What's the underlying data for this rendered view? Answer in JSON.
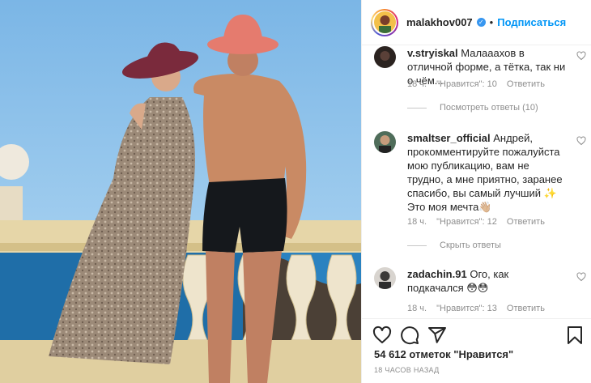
{
  "post": {
    "username": "malakhov007",
    "verified_icon": "verified-badge-icon",
    "separator": "•",
    "follow_label": "Подписаться"
  },
  "comments": [
    {
      "username": "v.stryiskal",
      "text": "Малааахов в отличной форме, а тётка, так ни о чём...",
      "time": "18 ч.",
      "likes": "\"Нравится\": 10",
      "reply": "Ответить",
      "replies_label": "Посмотреть ответы (10)"
    },
    {
      "username": "smaltser_official",
      "text": "Андрей, прокомментируйте пожалуйста мою публикацию, вам не трудно, а мне приятно, заранее спасибо, вы самый лучший ✨ Это моя мечта👋🏼",
      "time": "18 ч.",
      "likes": "\"Нравится\": 12",
      "reply": "Ответить",
      "replies_label": "Скрыть ответы"
    },
    {
      "username": "zadachin.91",
      "text": "Ого, как подкачался 😳😳",
      "time": "18 ч.",
      "likes": "\"Нравится\": 13",
      "reply": "Ответить"
    }
  ],
  "footer": {
    "likes_count": "54 612 отметок \"Нравится\"",
    "time_ago": "18 часов назад"
  },
  "icons": {
    "like": "heart-icon",
    "comment": "comment-icon",
    "share": "share-icon",
    "save": "bookmark-icon"
  },
  "colors": {
    "link_blue": "#0095f6",
    "verified_blue": "#3897f0",
    "muted_text": "#8e8e8e",
    "border": "#efefef"
  }
}
